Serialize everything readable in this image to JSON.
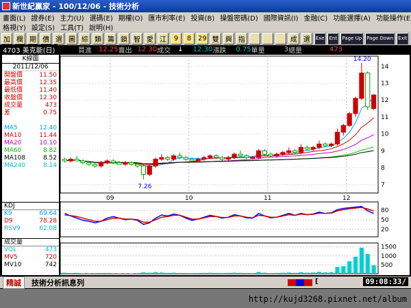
{
  "app": {
    "title": "新世紀贏家 - 100/12/06 - 技術分析"
  },
  "menu": {
    "row1": [
      "畫面(L)",
      "證券(E)",
      "主力(U)",
      "選碼(E)",
      "期權(O)",
      "匯市利率(E)",
      "投資(B)",
      "操盤密碼(D)",
      "國際資訊(I)",
      "金融(C)",
      "功能選擇(A)",
      "功能操作(E)"
    ],
    "row2": [
      "格視(Y)",
      "設定(S)",
      "工具(T)",
      "說明(H)"
    ]
  },
  "toolbar": {
    "buttons": [
      "加",
      "欄",
      "期",
      "價",
      "選",
      "圖",
      "綜",
      "類",
      "籌",
      "鎖",
      "智",
      "愛",
      "江",
      "9",
      "8",
      "29",
      "雙",
      "興",
      "指",
      "",
      "",
      "",
      "成",
      "選",
      "Exe",
      "Ent",
      "Page Up",
      "Page Down",
      "Exit"
    ]
  },
  "quote": {
    "code": "4703 美克能(日)",
    "buy_label": "買進",
    "buy": "12.25",
    "sell_label": "賣出",
    "sell": "12.30",
    "trade_label": "成交",
    "arrow": "↓",
    "change_value": "12.30",
    "change_label": "漲跌",
    "unit_value": "0.75",
    "unit_label": "單量",
    "total_value": "3",
    "total_label": "總量",
    "volume": "473"
  },
  "left": {
    "header": "K線圖",
    "date": "2011/12/06",
    "stats": [
      {
        "label": "開盤價",
        "value": "11.50",
        "color": "#c00"
      },
      {
        "label": "最高價",
        "value": "12.35",
        "color": "#c00"
      },
      {
        "label": "最低價",
        "value": "11.40",
        "color": "#c00"
      },
      {
        "label": "收盤價",
        "value": "12.30",
        "color": "#c00"
      },
      {
        "label": "成交量",
        "value": "473",
        "color": "#c00"
      },
      {
        "label": "差",
        "value": "0.75",
        "color": "#c00"
      }
    ],
    "ma": [
      {
        "label": "MA5",
        "value": "12.40",
        "color": "#00a0ff"
      },
      {
        "label": "MA10",
        "value": "11.44",
        "color": "#c00"
      },
      {
        "label": "MA20",
        "value": "10.10",
        "color": "#c000c0"
      },
      {
        "label": "MA60",
        "value": "8.82",
        "color": "#00c000"
      },
      {
        "label": "MA108",
        "value": "8.52",
        "color": "#000"
      },
      {
        "label": "MA240",
        "value": "8.14",
        "color": "#00c0c0"
      }
    ]
  },
  "kd": {
    "header": "KDJ",
    "rows": [
      {
        "label": "K9",
        "value": "69.64",
        "color": "#00a0ff"
      },
      {
        "label": "D9",
        "value": "78.28",
        "color": "#c00"
      },
      {
        "label": "RSV9",
        "value": "62.08",
        "color": "#00c0c0"
      }
    ]
  },
  "vol": {
    "header": "成交量",
    "rows": [
      {
        "label": "VOL",
        "value": "473",
        "color": "#00c0c0"
      },
      {
        "label": "MV5",
        "value": "720",
        "color": "#c00"
      },
      {
        "label": "MV10",
        "value": "742",
        "color": "#000"
      }
    ]
  },
  "chart_data": {
    "type": "line",
    "x_tick_labels": [
      "09",
      "10",
      "11",
      "12"
    ],
    "price_axis": [
      14,
      13,
      12,
      11,
      10,
      9,
      8,
      7
    ],
    "price_high_label": "14.20",
    "price_low_label": "7.26",
    "kd_axis": [
      80,
      50,
      20
    ],
    "vol_axis": [
      1500,
      1000,
      500
    ],
    "ylim_price": [
      6.5,
      14.6
    ],
    "ylim_kd": [
      0,
      100
    ],
    "ylim_vol": [
      0,
      1600
    ],
    "candles": [
      [
        8.5,
        8.6,
        8.3,
        8.4
      ],
      [
        8.4,
        8.6,
        8.3,
        8.5
      ],
      [
        8.5,
        8.7,
        8.4,
        8.4
      ],
      [
        8.4,
        8.5,
        8.2,
        8.3
      ],
      [
        8.3,
        8.4,
        8.1,
        8.2
      ],
      [
        8.2,
        8.3,
        8.0,
        8.1
      ],
      [
        8.1,
        8.4,
        8.0,
        8.3
      ],
      [
        8.3,
        8.5,
        8.2,
        8.4
      ],
      [
        8.4,
        8.5,
        8.2,
        8.3
      ],
      [
        8.3,
        8.4,
        8.2,
        8.2
      ],
      [
        8.2,
        8.4,
        8.1,
        8.3
      ],
      [
        8.3,
        8.4,
        8.1,
        8.2
      ],
      [
        8.2,
        8.3,
        8.0,
        8.1
      ],
      [
        8.1,
        8.2,
        7.3,
        7.6
      ],
      [
        7.6,
        8.2,
        7.5,
        8.1
      ],
      [
        8.1,
        8.6,
        8.0,
        8.5
      ],
      [
        8.5,
        8.8,
        8.4,
        8.6
      ],
      [
        8.6,
        8.7,
        8.4,
        8.5
      ],
      [
        8.5,
        8.8,
        8.4,
        8.7
      ],
      [
        8.7,
        8.9,
        8.5,
        8.6
      ],
      [
        8.6,
        8.7,
        8.4,
        8.5
      ],
      [
        8.5,
        8.6,
        8.3,
        8.4
      ],
      [
        8.4,
        8.6,
        8.3,
        8.5
      ],
      [
        8.5,
        8.7,
        8.4,
        8.6
      ],
      [
        8.6,
        8.8,
        8.5,
        8.7
      ],
      [
        8.7,
        8.8,
        8.5,
        8.6
      ],
      [
        8.6,
        8.7,
        8.4,
        8.5
      ],
      [
        8.5,
        8.7,
        8.4,
        8.6
      ],
      [
        8.6,
        8.9,
        8.5,
        8.8
      ],
      [
        8.8,
        9.0,
        8.6,
        8.7
      ],
      [
        8.7,
        8.8,
        8.5,
        8.6
      ],
      [
        8.6,
        8.7,
        8.5,
        8.6
      ],
      [
        8.6,
        9.1,
        8.5,
        9.0
      ],
      [
        9.0,
        9.1,
        8.7,
        8.8
      ],
      [
        8.8,
        8.9,
        8.6,
        8.7
      ],
      [
        8.7,
        8.9,
        8.6,
        8.8
      ],
      [
        8.8,
        9.0,
        8.7,
        8.9
      ],
      [
        8.9,
        9.2,
        8.8,
        9.0
      ],
      [
        9.0,
        9.1,
        8.8,
        8.9
      ],
      [
        8.9,
        9.4,
        8.8,
        9.2
      ],
      [
        9.2,
        9.3,
        9.0,
        9.1
      ],
      [
        9.1,
        9.3,
        9.0,
        9.2
      ],
      [
        9.2,
        9.6,
        9.1,
        9.4
      ],
      [
        9.4,
        9.5,
        9.2,
        9.3
      ],
      [
        9.3,
        9.5,
        9.2,
        9.4
      ],
      [
        9.4,
        10.3,
        9.3,
        10.1
      ],
      [
        10.1,
        10.6,
        9.9,
        10.5
      ],
      [
        10.5,
        11.3,
        10.4,
        11.2
      ],
      [
        11.2,
        12.2,
        11.0,
        12.1
      ],
      [
        12.1,
        14.2,
        12.0,
        13.6
      ],
      [
        13.6,
        13.7,
        11.4,
        11.6
      ],
      [
        11.5,
        12.35,
        11.4,
        12.3
      ]
    ],
    "k_series": [
      70,
      62,
      55,
      48,
      45,
      40,
      45,
      55,
      60,
      55,
      50,
      52,
      48,
      35,
      40,
      55,
      65,
      62,
      68,
      64,
      55,
      48,
      52,
      58,
      64,
      60,
      55,
      58,
      66,
      62,
      56,
      55,
      70,
      62,
      56,
      58,
      64,
      70,
      64,
      70,
      66,
      68,
      74,
      70,
      72,
      82,
      86,
      88,
      90,
      92,
      78,
      70
    ],
    "d_series": [
      65,
      63,
      60,
      55,
      50,
      45,
      45,
      50,
      55,
      55,
      52,
      52,
      50,
      42,
      42,
      50,
      58,
      60,
      64,
      64,
      58,
      52,
      52,
      56,
      60,
      60,
      57,
      57,
      62,
      62,
      58,
      56,
      64,
      62,
      58,
      58,
      62,
      66,
      64,
      68,
      66,
      67,
      71,
      70,
      71,
      78,
      82,
      85,
      87,
      89,
      84,
      78
    ],
    "volume": [
      60,
      40,
      50,
      30,
      30,
      35,
      40,
      45,
      30,
      25,
      30,
      20,
      30,
      80,
      60,
      90,
      70,
      50,
      60,
      45,
      40,
      35,
      40,
      50,
      55,
      45,
      40,
      50,
      60,
      50,
      40,
      35,
      100,
      60,
      40,
      45,
      55,
      70,
      50,
      90,
      60,
      70,
      110,
      80,
      90,
      380,
      420,
      700,
      950,
      1450,
      1100,
      473
    ]
  },
  "status": {
    "badge": "精誠",
    "message": "技術分析訊息列",
    "bracket": "[",
    "time": "09:08:33/"
  },
  "footer": {
    "url": "http://kujd3268.pixnet.net/album"
  }
}
